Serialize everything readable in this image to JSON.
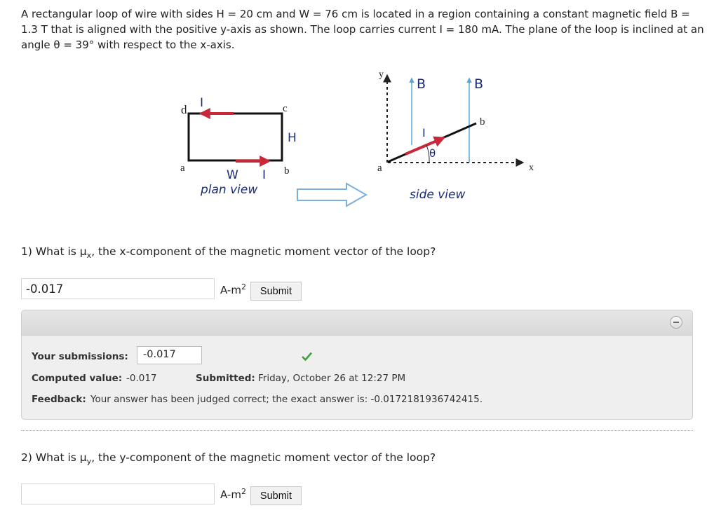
{
  "problem": {
    "text": "A rectangular loop of wire with sides H = 20 cm and W = 76 cm is located in a region containing a constant magnetic field B = 1.3 T that is aligned with the positive y-axis as shown. The loop carries current I = 180 mA. The plane of the loop is inclined at an angle θ = 39° with respect to the x-axis."
  },
  "figure": {
    "plan": {
      "corner_d": "d",
      "corner_c": "c",
      "corner_a": "a",
      "corner_b": "b",
      "label_H": "H",
      "label_W": "W",
      "label_I_top": "I",
      "label_I_bottom": "I",
      "caption": "plan view"
    },
    "side": {
      "axis_y": "y",
      "axis_x": "x",
      "label_B_left": "B",
      "label_B_right": "B",
      "label_I": "I",
      "label_theta": "θ",
      "point_a": "a",
      "point_b": "b",
      "caption": "side view"
    },
    "colors": {
      "wire": "#111111",
      "current_arrow": "#c8283a",
      "field_line": "#5aa6d6",
      "transition_arrow": "#7cb0d9",
      "caption": "#1a2d7a"
    }
  },
  "question1": {
    "prefix": "1) What is ",
    "symbol": "μ",
    "subscript": "x",
    "suffix": ", the x-component of the magnetic moment vector of the loop?",
    "answer_value": "-0.017",
    "unit_base": "A-m",
    "unit_exp": "2",
    "submit_label": "Submit"
  },
  "feedback": {
    "submissions_label": "Your submissions:",
    "submission_value": "-0.017",
    "computed_label": "Computed value:",
    "computed_value": "-0.017",
    "submitted_label": "Submitted:",
    "submitted_value": "Friday, October 26 at 12:27 PM",
    "feedback_label": "Feedback:",
    "feedback_value": "Your answer has been judged correct; the exact answer is: -0.0172181936742415.",
    "collapse_icon": "minus-circle-icon",
    "check_icon": "check-icon",
    "check_color": "#3aa33a"
  },
  "question2": {
    "prefix": "2) What is ",
    "symbol": "μ",
    "subscript": "y",
    "suffix": ", the y-component of the magnetic moment vector of the loop?",
    "answer_value": "",
    "unit_base": "A-m",
    "unit_exp": "2",
    "submit_label": "Submit"
  }
}
